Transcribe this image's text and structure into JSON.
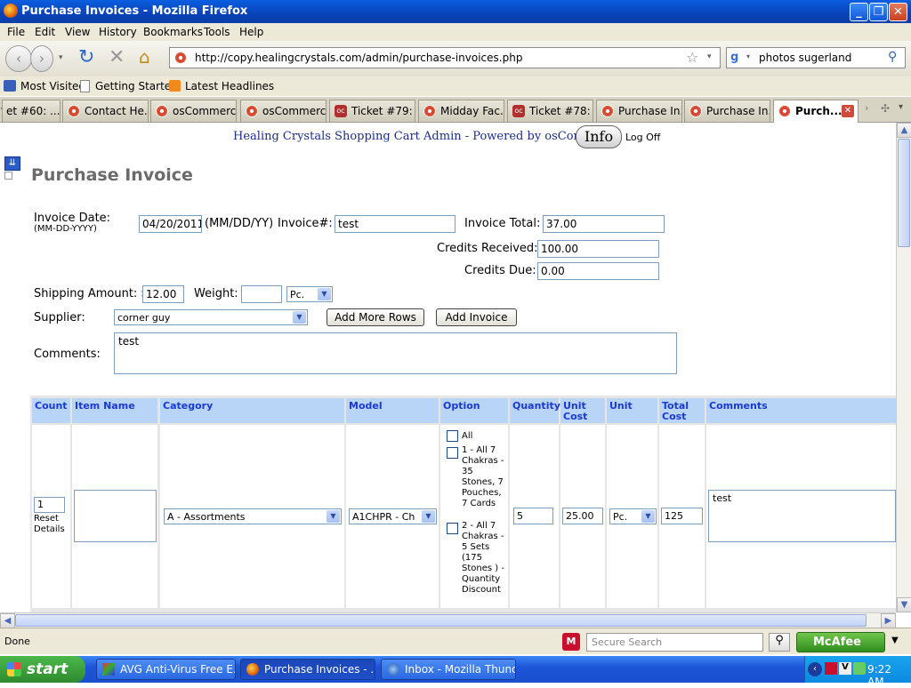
{
  "window": {
    "title": "Purchase Invoices - Mozilla Firefox"
  },
  "menu": [
    "File",
    "Edit",
    "View",
    "History",
    "Bookmarks",
    "Tools",
    "Help"
  ],
  "address": {
    "url": "http://copy.healingcrystals.com/admin/purchase-invoices.php"
  },
  "search": {
    "value": "photos sugerland"
  },
  "bookmarks": [
    "Most Visited",
    "Getting Started",
    "Latest Headlines"
  ],
  "tabs": [
    {
      "label": "et #60: ...",
      "icon": "oscommerce"
    },
    {
      "label": "Contact He...",
      "icon": "oscommerce"
    },
    {
      "label": "osCommerc...",
      "icon": "oscommerce"
    },
    {
      "label": "osCommerc...",
      "icon": "oscommerce"
    },
    {
      "label": "Ticket #79: ...",
      "icon": "oc"
    },
    {
      "label": "Midday Fac...",
      "icon": "oscommerce"
    },
    {
      "label": "Ticket #78: ...",
      "icon": "oc"
    },
    {
      "label": "Purchase In...",
      "icon": "oscommerce"
    },
    {
      "label": "Purchase In...",
      "icon": "oscommerce"
    },
    {
      "label": "Purch...",
      "icon": "oscommerce",
      "active": true
    }
  ],
  "header": {
    "brand": "Healing Crystals Shopping Cart Admin - Powered by osCommerce",
    "info": "Info",
    "logoff": "Log Off"
  },
  "page": {
    "title": "Purchase Invoice"
  },
  "form": {
    "invoice_date_label": "Invoice Date:",
    "invoice_date_hint": "(MM-DD-YYYY)",
    "invoice_date": "04/20/2011",
    "date_format": "(MM/DD/YY)",
    "invoice_no_label": "Invoice#:",
    "invoice_no": "test",
    "invoice_total_label": "Invoice Total:",
    "invoice_total": "37.00",
    "credits_received_label": "Credits Received:",
    "credits_received": "100.00",
    "credits_due_label": "Credits Due:",
    "credits_due": "0.00",
    "shipping_label": "Shipping Amount: $",
    "shipping": "12.00",
    "weight_label": "Weight:",
    "weight": "",
    "weight_unit": "Pc.",
    "supplier_label": "Supplier:",
    "supplier": "corner guy",
    "add_rows": "Add More Rows",
    "add_invoice": "Add Invoice",
    "comments_label": "Comments:",
    "comments": "test"
  },
  "grid": {
    "headers": [
      "Count",
      "Item Name",
      "Category",
      "Model",
      "Option",
      "Quantity",
      "Unit Cost",
      "Unit",
      "Total Cost",
      "Comments"
    ],
    "row": {
      "count": "1",
      "reset": "Reset Details",
      "item_name": "",
      "category": "A - Assortments",
      "model": "A1CHPR - Ch",
      "options": [
        {
          "label": "All",
          "checked": false
        },
        {
          "label": "1 - All 7 Chakras - 35 Stones, 7 Pouches, 7 Cards",
          "checked": false
        },
        {
          "label": "2 - All 7 Chakras - 5 Sets (175 Stones ) - Quantity Discount",
          "checked": false
        }
      ],
      "quantity": "5",
      "unit_cost": "25.00",
      "unit": "Pc.",
      "total_cost": "125",
      "comments": "test"
    }
  },
  "status": {
    "text": "Done",
    "secure_search_placeholder": "Secure Search",
    "mcafee": "McAfee"
  },
  "taskbar": {
    "start": "start",
    "tasks": [
      "AVG Anti-Virus Free E...",
      "Purchase Invoices - ...",
      "Inbox - Mozilla Thund..."
    ],
    "clock": "9:22 AM"
  }
}
